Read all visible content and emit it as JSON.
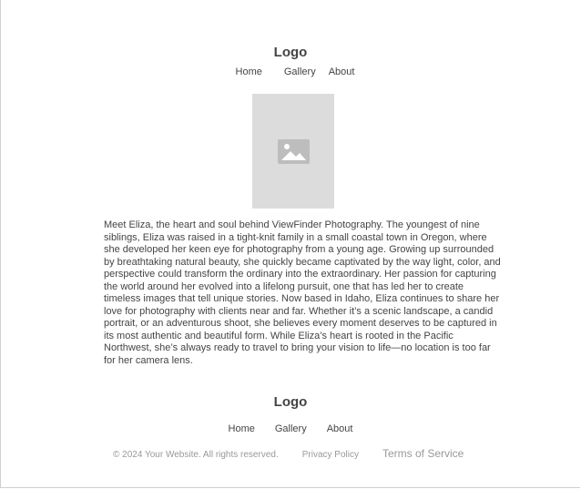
{
  "header": {
    "logo": "Logo",
    "nav": [
      "Home",
      "Gallery",
      "About"
    ]
  },
  "hero": {
    "image_icon": "image-placeholder-icon"
  },
  "bio": {
    "text": "Meet Eliza, the heart and soul behind ViewFinder Photography. The youngest of nine siblings, Eliza was raised in a tight-knit family in a small coastal town in Oregon, where she developed her keen eye for photography from a young age. Growing up surrounded by breathtaking natural beauty, she quickly became captivated by the way light, color, and perspective could transform the ordinary into the extraordinary. Her passion for capturing the world around her evolved into a lifelong pursuit, one that has led her to create timeless images that tell unique stories. Now based in Idaho, Eliza continues to share her love for photography with clients near and far. Whether it’s a scenic landscape, a candid portrait, or an adventurous shoot, she believes every moment deserves to be captured in its most authentic and beautiful form. While Eliza’s heart is rooted in the Pacific Northwest, she’s always ready to travel to bring your vision to life—no location is too far for her camera lens."
  },
  "footer": {
    "logo": "Logo",
    "nav": [
      "Home",
      "Gallery",
      "About"
    ],
    "copyright": "© 2024 Your Website. All rights reserved.",
    "privacy": "Privacy Policy",
    "terms": "Terms of Service"
  }
}
